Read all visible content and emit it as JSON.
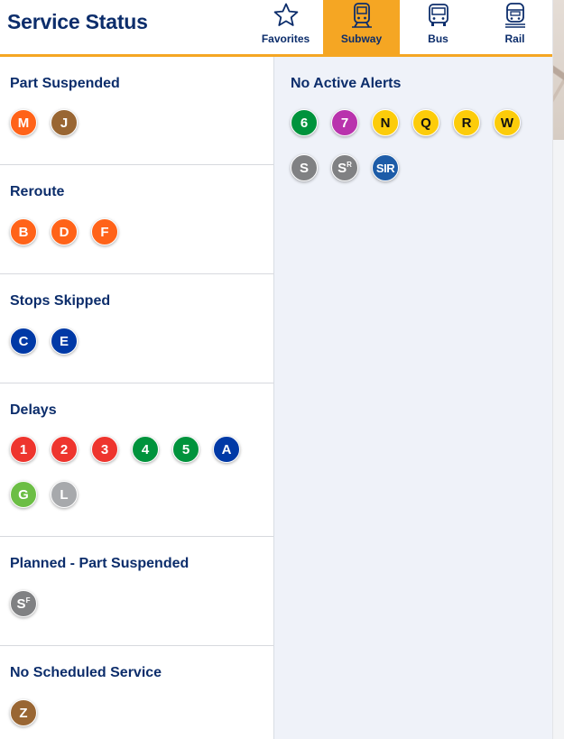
{
  "header": {
    "title": "Service Status",
    "tabs": [
      {
        "id": "favorites",
        "label": "Favorites",
        "icon": "star-icon",
        "active": false
      },
      {
        "id": "subway",
        "label": "Subway",
        "icon": "subway-icon",
        "active": true
      },
      {
        "id": "bus",
        "label": "Bus",
        "icon": "bus-icon",
        "active": false
      },
      {
        "id": "rail",
        "label": "Rail",
        "icon": "rail-icon",
        "active": false
      }
    ]
  },
  "colors": {
    "navy": "#0c2d6b",
    "accent": "#f5a623",
    "line_orange": "#ff6319",
    "line_brown": "#996633",
    "line_blue": "#0039a6",
    "line_red": "#ee352e",
    "line_green": "#00933c",
    "line_lime": "#6cbe45",
    "line_gray": "#a7a9ac",
    "line_darkgray": "#808183",
    "line_purple": "#b933ad",
    "line_yellow": "#fccc0a",
    "line_sir": "#1d5ca8"
  },
  "sections": [
    {
      "title": "Part Suspended",
      "lines": [
        {
          "text": "M",
          "color": "#ff6319"
        },
        {
          "text": "J",
          "color": "#996633"
        }
      ]
    },
    {
      "title": "Reroute",
      "lines": [
        {
          "text": "B",
          "color": "#ff6319"
        },
        {
          "text": "D",
          "color": "#ff6319"
        },
        {
          "text": "F",
          "color": "#ff6319"
        }
      ]
    },
    {
      "title": "Stops Skipped",
      "lines": [
        {
          "text": "C",
          "color": "#0039a6"
        },
        {
          "text": "E",
          "color": "#0039a6"
        }
      ]
    },
    {
      "title": "Delays",
      "lines": [
        {
          "text": "1",
          "color": "#ee352e"
        },
        {
          "text": "2",
          "color": "#ee352e"
        },
        {
          "text": "3",
          "color": "#ee352e"
        },
        {
          "text": "4",
          "color": "#00933c"
        },
        {
          "text": "5",
          "color": "#00933c"
        },
        {
          "text": "A",
          "color": "#0039a6"
        },
        {
          "text": "G",
          "color": "#6cbe45"
        },
        {
          "text": "L",
          "color": "#a7a9ac"
        }
      ]
    },
    {
      "title": "Planned - Part Suspended",
      "lines": [
        {
          "text": "S",
          "sup": "F",
          "color": "#808183"
        }
      ]
    },
    {
      "title": "No Scheduled Service",
      "lines": [
        {
          "text": "Z",
          "color": "#996633"
        }
      ]
    }
  ],
  "no_alerts": {
    "title": "No Active Alerts",
    "lines": [
      {
        "text": "6",
        "color": "#00933c"
      },
      {
        "text": "7",
        "color": "#b933ad"
      },
      {
        "text": "N",
        "color": "#fccc0a",
        "dark": true
      },
      {
        "text": "Q",
        "color": "#fccc0a",
        "dark": true
      },
      {
        "text": "R",
        "color": "#fccc0a",
        "dark": true
      },
      {
        "text": "W",
        "color": "#fccc0a",
        "dark": true
      },
      {
        "text": "S",
        "color": "#808183"
      },
      {
        "text": "S",
        "sup": "R",
        "color": "#808183"
      },
      {
        "text": "SIR",
        "color": "#1d5ca8"
      }
    ]
  }
}
